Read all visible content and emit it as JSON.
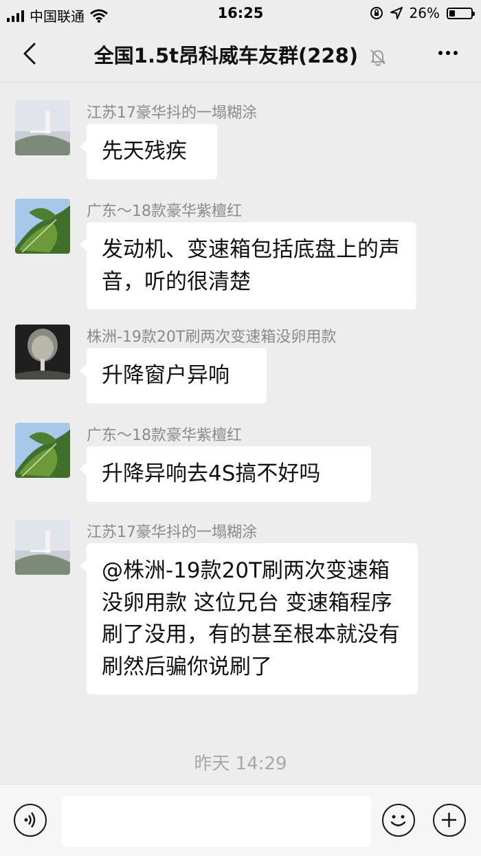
{
  "status_bar": {
    "carrier": "中国联通",
    "time": "16:25",
    "battery": "26%",
    "battery_level": 0.26
  },
  "header": {
    "title": "全国1.5t昂科威车友群(228)"
  },
  "messages": [
    {
      "sender": "江苏17豪华抖的一塌糊涂",
      "text": "先天残疾",
      "avatar": "avatar-poster"
    },
    {
      "sender": "广东～18款豪华紫檀红",
      "text": "发动机、变速箱包括底盘上的声音，听的很清楚",
      "avatar": "avatar-leaf"
    },
    {
      "sender": "株洲-19款20T刷两次变速箱没卵用款",
      "text": "升降窗户异响",
      "avatar": "avatar-buddha"
    },
    {
      "sender": "广东～18款豪华紫檀红",
      "text": "升降异响去4S搞不好吗",
      "avatar": "avatar-leaf"
    },
    {
      "sender": "江苏17豪华抖的一塌糊涂",
      "text": "@株洲-19款20T刷两次变速箱没卵用款  这位兄台 变速箱程序刷了没用，有的甚至根本就没有刷然后骗你说刷了",
      "avatar": "avatar-poster"
    }
  ],
  "time_divider": "昨天 14:29",
  "input": {
    "value": ""
  }
}
